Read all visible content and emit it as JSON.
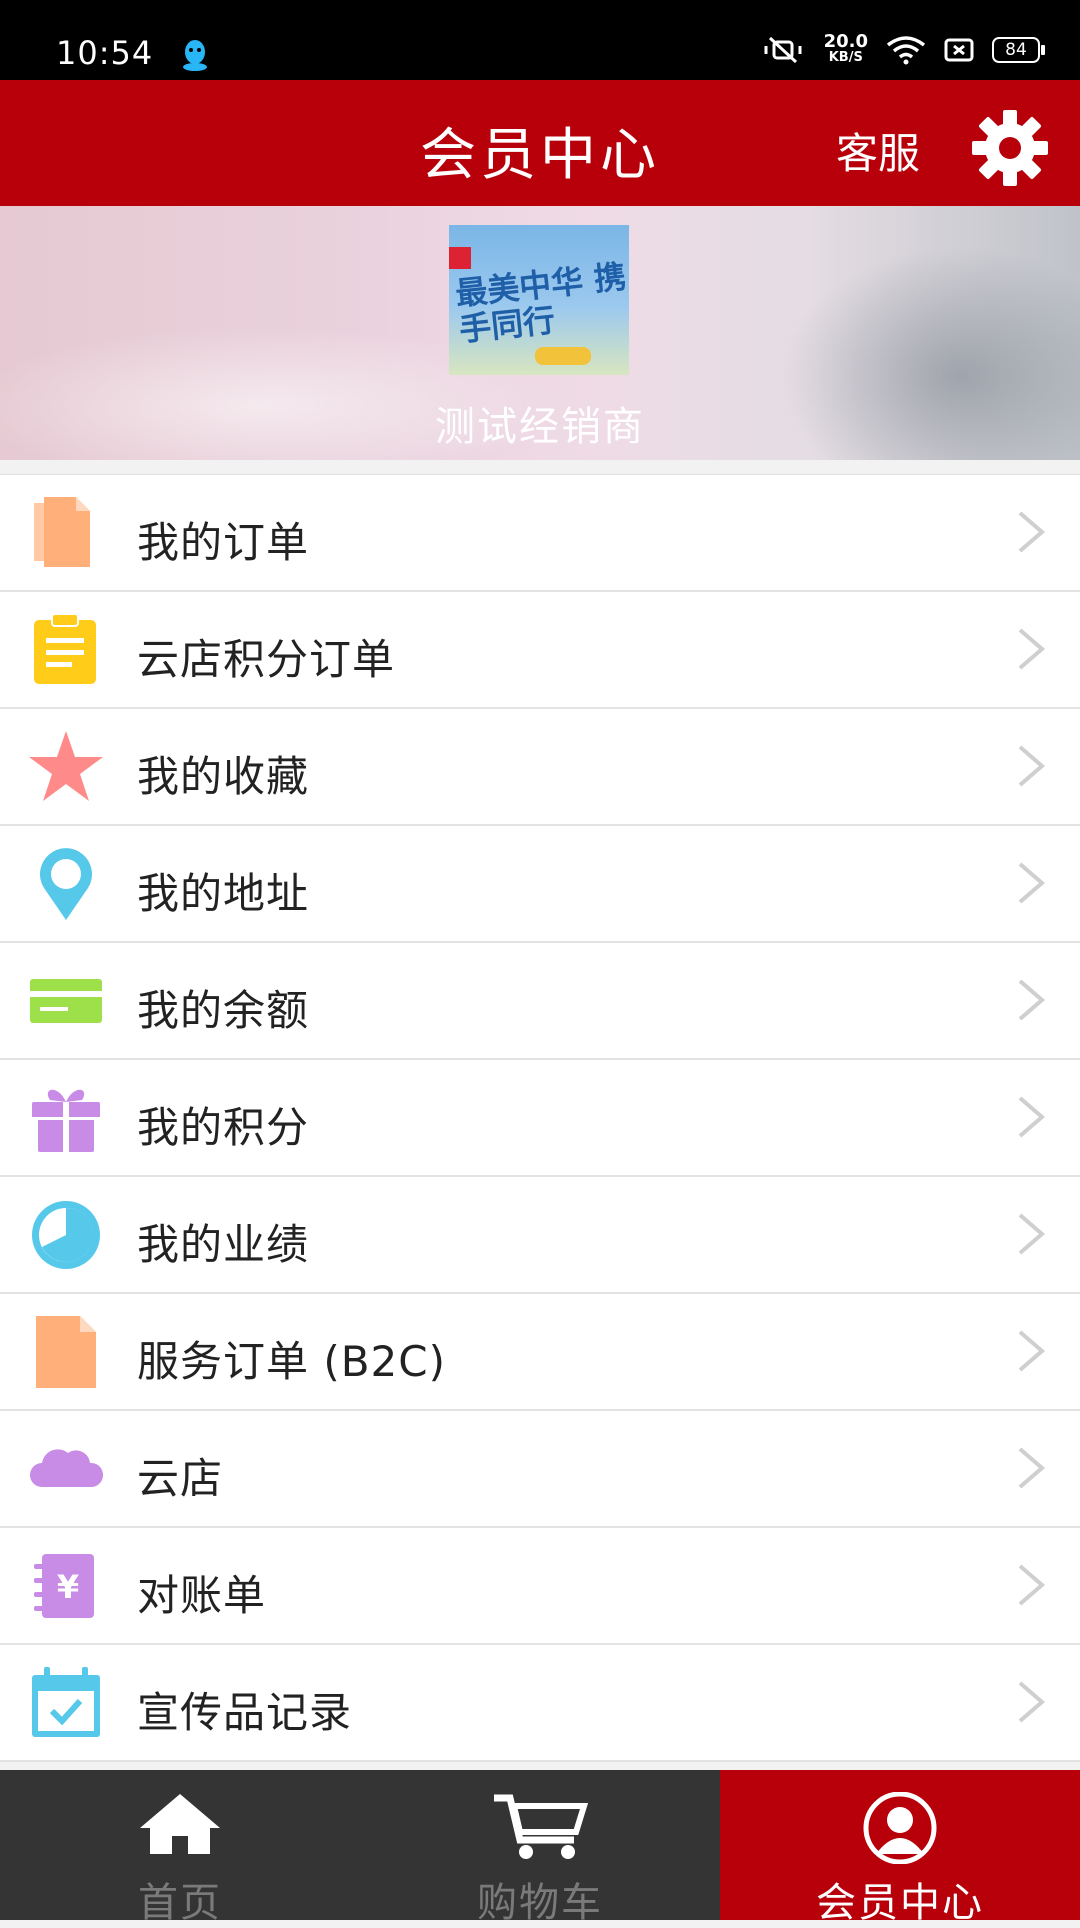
{
  "status_bar": {
    "time": "10:54",
    "speed_value": "20.0",
    "speed_unit": "KB/S",
    "battery": "84",
    "icons": [
      "qq-icon",
      "vibrate-icon",
      "wifi-icon",
      "sim-icon",
      "battery-icon"
    ]
  },
  "header": {
    "title": "会员中心",
    "service_label": "客服",
    "settings_icon": "gear-icon",
    "background_color": "#b8000a"
  },
  "profile": {
    "avatar_text": "最美中华 携手同行",
    "name": "测试经销商"
  },
  "menu": [
    {
      "label": "我的订单",
      "icon": "orders-icon",
      "color": "#ffb07a"
    },
    {
      "label": "云店积分订单",
      "icon": "clipboard-icon",
      "color": "#ffcc1a"
    },
    {
      "label": "我的收藏",
      "icon": "star-icon",
      "color": "#ff8a8a"
    },
    {
      "label": "我的地址",
      "icon": "location-pin-icon",
      "color": "#56c8ea"
    },
    {
      "label": "我的余额",
      "icon": "card-icon",
      "color": "#9ee04a"
    },
    {
      "label": "我的积分",
      "icon": "gift-icon",
      "color": "#c88be6"
    },
    {
      "label": "我的业绩",
      "icon": "pie-chart-icon",
      "color": "#56c8ea"
    },
    {
      "label": "服务订单 (B2C)",
      "icon": "document-icon",
      "color": "#ffb07a"
    },
    {
      "label": "云店",
      "icon": "cloud-icon",
      "color": "#c88be6"
    },
    {
      "label": "对账单",
      "icon": "bill-icon",
      "color": "#c88be6"
    },
    {
      "label": "宣传品记录",
      "icon": "calendar-check-icon",
      "color": "#56c8ea"
    }
  ],
  "tabbar": {
    "tabs": [
      {
        "label": "首页",
        "icon": "home-icon",
        "active": false
      },
      {
        "label": "购物车",
        "icon": "cart-icon",
        "active": false
      },
      {
        "label": "会员中心",
        "icon": "user-icon",
        "active": true
      }
    ]
  }
}
